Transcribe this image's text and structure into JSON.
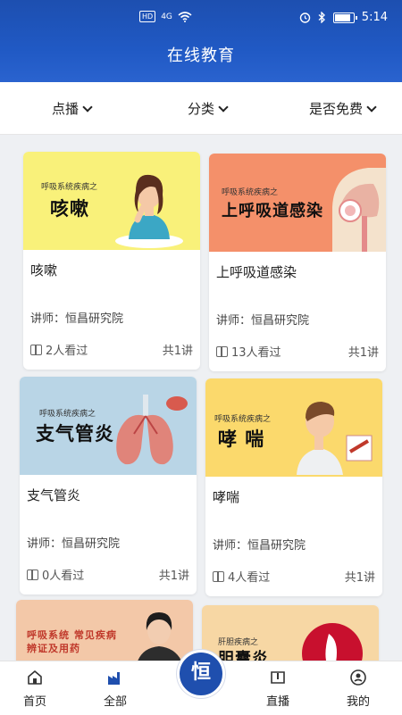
{
  "status_bar": {
    "network": "4G",
    "time": "5:14",
    "battery_percent": 80
  },
  "header": {
    "title": "在线教育"
  },
  "filters": [
    {
      "label": "点播"
    },
    {
      "label": "分类"
    },
    {
      "label": "是否免费"
    }
  ],
  "courses": [
    {
      "name": "咳嗽",
      "teacher": "讲师：恒昌研究院",
      "viewed": "2人看过",
      "lessons": "共1讲",
      "thumb_small": "呼吸系统疾病之",
      "thumb_big": "咳嗽",
      "thumb_bg": "#f9f17a"
    },
    {
      "name": "上呼吸道感染",
      "teacher": "讲师：恒昌研究院",
      "viewed": "13人看过",
      "lessons": "共1讲",
      "thumb_small": "呼吸系统疾病之",
      "thumb_big": "上呼吸道感染",
      "thumb_bg": "#f4906a"
    },
    {
      "name": "支气管炎",
      "teacher": "讲师：恒昌研究院",
      "viewed": "0人看过",
      "lessons": "共1讲",
      "thumb_small": "呼吸系统疾病之",
      "thumb_big": "支气管炎",
      "thumb_bg": "#b9d5e6"
    },
    {
      "name": "哮喘",
      "teacher": "讲师：恒昌研究院",
      "viewed": "4人看过",
      "lessons": "共1讲",
      "thumb_small": "呼吸系统疾病之",
      "thumb_big": "哮 喘",
      "thumb_bg": "#fbd96c"
    },
    {
      "name": "",
      "teacher": "",
      "viewed": "",
      "lessons": "",
      "thumb_small": "",
      "thumb_big": "呼吸系统 常见疾病辨证及用药",
      "thumb_bg": "#f3c8a8"
    },
    {
      "name": "",
      "teacher": "",
      "viewed": "",
      "lessons": "",
      "thumb_small": "肝胆疾病之",
      "thumb_big": "胆囊炎",
      "thumb_bg": "#f7d7a4"
    }
  ],
  "tabbar": {
    "items": [
      {
        "label": "首页",
        "icon": "home-icon"
      },
      {
        "label": "全部",
        "icon": "factory-icon"
      },
      {
        "label": "直播",
        "icon": "live-icon"
      },
      {
        "label": "我的",
        "icon": "profile-icon"
      }
    ],
    "center_logo": "恒"
  },
  "colors": {
    "brand": "#1f4fae",
    "active_tab": "#1f4fae"
  }
}
